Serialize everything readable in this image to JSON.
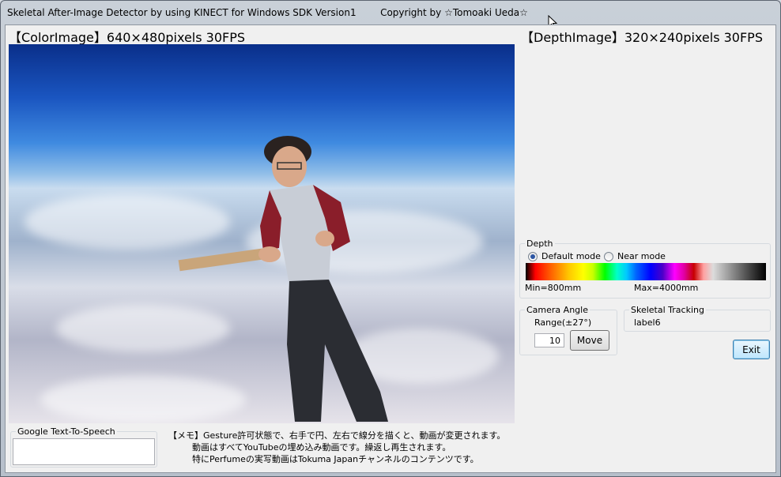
{
  "window": {
    "title": "Skeletal After-Image Detector by using KINECT for Windows SDK Version1        Copyright by ☆Tomoaki Ueda☆"
  },
  "color_image": {
    "heading": "【ColorImage】640×480pixels 30FPS"
  },
  "depth_image": {
    "heading": "【DepthImage】320×240pixels 30FPS"
  },
  "depth_group": {
    "label": "Depth",
    "default_mode_label": "Default mode",
    "near_mode_label": "Near mode",
    "selected": "default",
    "min_label": "Min=800mm",
    "max_label": "Max=4000mm"
  },
  "camera_angle": {
    "label": "Camera Angle",
    "range_label": "Range(±27°)",
    "value": "10",
    "move_label": "Move"
  },
  "skeletal_tracking": {
    "label": "Skeletal Tracking",
    "value": "label6"
  },
  "exit_label": "Exit",
  "tts": {
    "label": "Google Text-To-Speech",
    "value": ""
  },
  "memo": {
    "line1": "【メモ】Gesture許可状態で、右手で円、左右で線分を描くと、動画が変更されます。",
    "line2": "動画はすべてYouTubeの埋め込み動画です。繰返し再生されます。",
    "line3": "特にPerfumeの実写動画はTokuma Japanチャンネルのコンテンツです。"
  },
  "colors": {
    "client_bg": "#f0f0f0",
    "radio_dot": "#2b55a3"
  }
}
